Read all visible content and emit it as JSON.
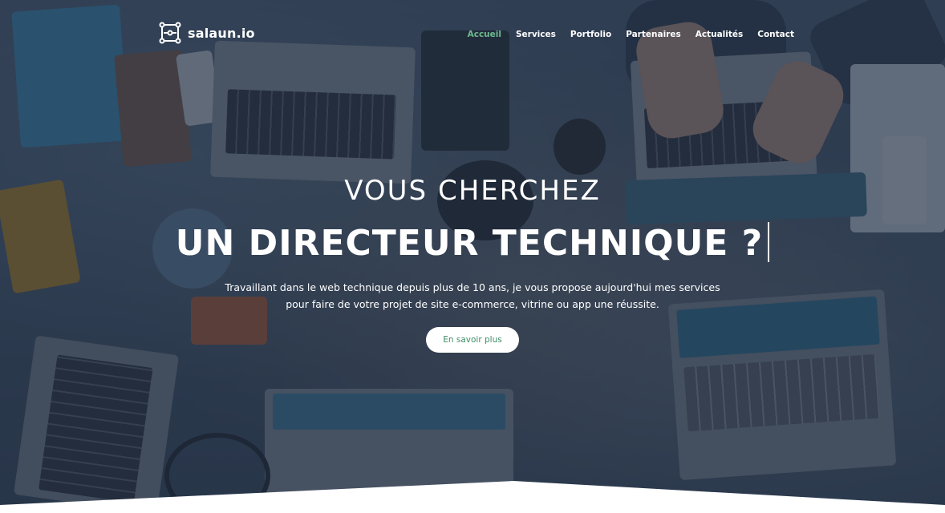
{
  "brand": {
    "name": "salaun.io",
    "icon": "circuit-logo-icon"
  },
  "nav": {
    "items": [
      {
        "label": "Accueil",
        "active": true
      },
      {
        "label": "Services",
        "active": false
      },
      {
        "label": "Portfolio",
        "active": false
      },
      {
        "label": "Partenaires",
        "active": false
      },
      {
        "label": "Actualités",
        "active": false
      },
      {
        "label": "Contact",
        "active": false
      }
    ],
    "active_color": "#6fb98f"
  },
  "hero": {
    "kicker": "VOUS CHERCHEZ",
    "headline": "UN DIRECTEUR TECHNIQUE ?",
    "description_line1": "Travaillant dans le web technique depuis plus de 10 ans, je vous propose aujourd'hui mes services",
    "description_line2": "pour faire de votre projet de site e-commerce, vitrine ou app une réussite.",
    "cta_label": "En savoir plus",
    "cta_color": "#3e8e66"
  }
}
